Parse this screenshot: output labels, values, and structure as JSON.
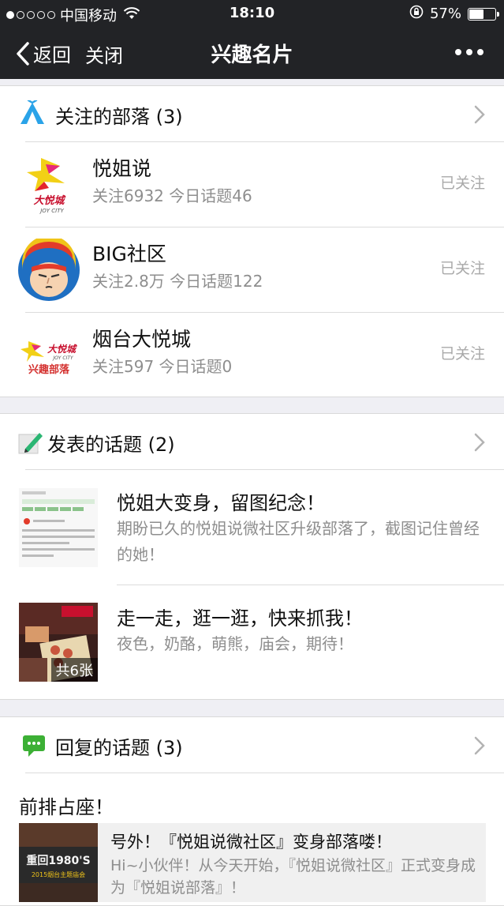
{
  "status_bar": {
    "carrier": "中国移动",
    "time": "18:10",
    "battery_text": "57%",
    "battery_level": 0.57,
    "signal_bars_filled": 1,
    "signal_bars_total": 5
  },
  "nav": {
    "back_label": "返回",
    "close_label": "关闭",
    "title": "兴趣名片"
  },
  "tribes_section": {
    "title": "关注的部落 (3)",
    "items": [
      {
        "name": "悦姐说",
        "stats": "关注6932  今日话题46",
        "status": "已关注",
        "logo_text": "大悦城",
        "logo_sub": "JOY CITY"
      },
      {
        "name": "BIG社区",
        "stats": "关注2.8万  今日话题122",
        "status": "已关注"
      },
      {
        "name": "烟台大悦城",
        "stats": "关注597  今日话题0",
        "status": "已关注",
        "logo_text": "大悦城",
        "logo_sub": "JOY CITY",
        "logo_text2": "兴趣部落"
      }
    ]
  },
  "posted_section": {
    "title": "发表的话题 (2)",
    "items": [
      {
        "title": "悦姐大变身，留图纪念！",
        "desc": "期盼已久的悦姐说微社区升级部落了，截图记住曾经的她！"
      },
      {
        "title": "走一走，逛一逛，快来抓我！",
        "desc": "夜色，奶酪，萌熊，庙会，期待！",
        "badge": "共6张"
      }
    ]
  },
  "reply_section": {
    "title": "回复的话题 (3)",
    "first_reply": "前排占座！",
    "quoted": {
      "title": "号外！『悦姐说微社区』变身部落喽！",
      "desc": "Hi~小伙伴！从今天开始，『悦姐说微社区』正式变身成为『悦姐说部落』！",
      "thumb_text": "重回1980'S",
      "thumb_sub": "2015烟台主题庙会"
    }
  },
  "colors": {
    "nav_bg": "#222326",
    "muted_text": "#8e8e8e",
    "followed_text": "#a9a9a9",
    "page_bg": "#efeff4"
  }
}
